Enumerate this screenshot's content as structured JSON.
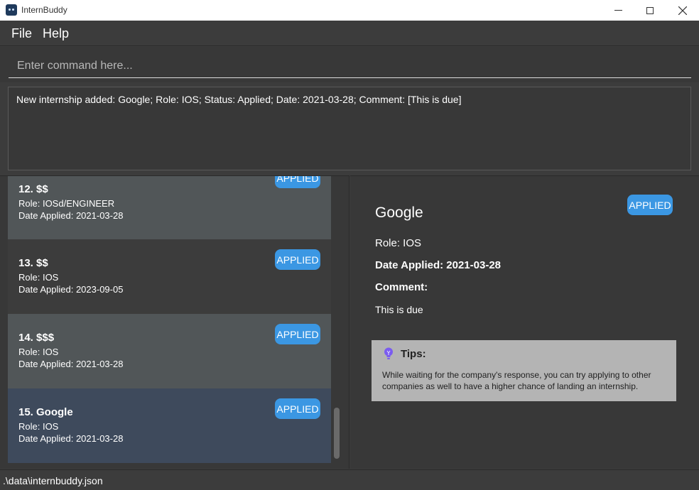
{
  "window": {
    "title": "InternBuddy",
    "icons": {
      "app": "robot-app-icon",
      "minimize": "minimize-icon",
      "maximize": "maximize-icon",
      "close": "close-icon"
    }
  },
  "menu": {
    "file": "File",
    "help": "Help"
  },
  "command": {
    "placeholder": "Enter command here...",
    "value": ""
  },
  "result": {
    "text": "New internship added: Google; Role: IOS; Status: Applied; Date: 2021-03-28; Comment: [This is due]"
  },
  "internships": [
    {
      "title": "12.  $$",
      "role": "Role: IOSd/ENGINEER",
      "date": "Date Applied: 2021-03-28",
      "status": "APPLIED",
      "bg": "#515658"
    },
    {
      "title": "13.  $$",
      "role": "Role: IOS",
      "date": "Date Applied: 2023-09-05",
      "status": "APPLIED",
      "bg": "#3c3c3c"
    },
    {
      "title": "14.  $$$",
      "role": "Role: IOS",
      "date": "Date Applied: 2021-03-28",
      "status": "APPLIED",
      "bg": "#515658"
    },
    {
      "title": "15.  Google",
      "role": "Role: IOS",
      "date": "Date Applied: 2021-03-28",
      "status": "APPLIED",
      "bg": "#3e4a5c"
    }
  ],
  "detail": {
    "status": "APPLIED",
    "company": "Google",
    "role": "Role: IOS",
    "date": "Date Applied: 2021-03-28",
    "comment_label": "Comment:",
    "comment": "This is due"
  },
  "tips": {
    "icon": "lightbulb-icon",
    "title": "Tips:",
    "text": "While waiting for the company's response, you can try applying to other companies as well to have a higher chance of landing an internship."
  },
  "status_bar": {
    "path": ".\\data\\internbuddy.json"
  },
  "colors": {
    "accent": "#3b97e3",
    "background": "#3c3c3c",
    "tips_bg": "#b4b4b4",
    "selected_card": "#3e4a5c"
  }
}
